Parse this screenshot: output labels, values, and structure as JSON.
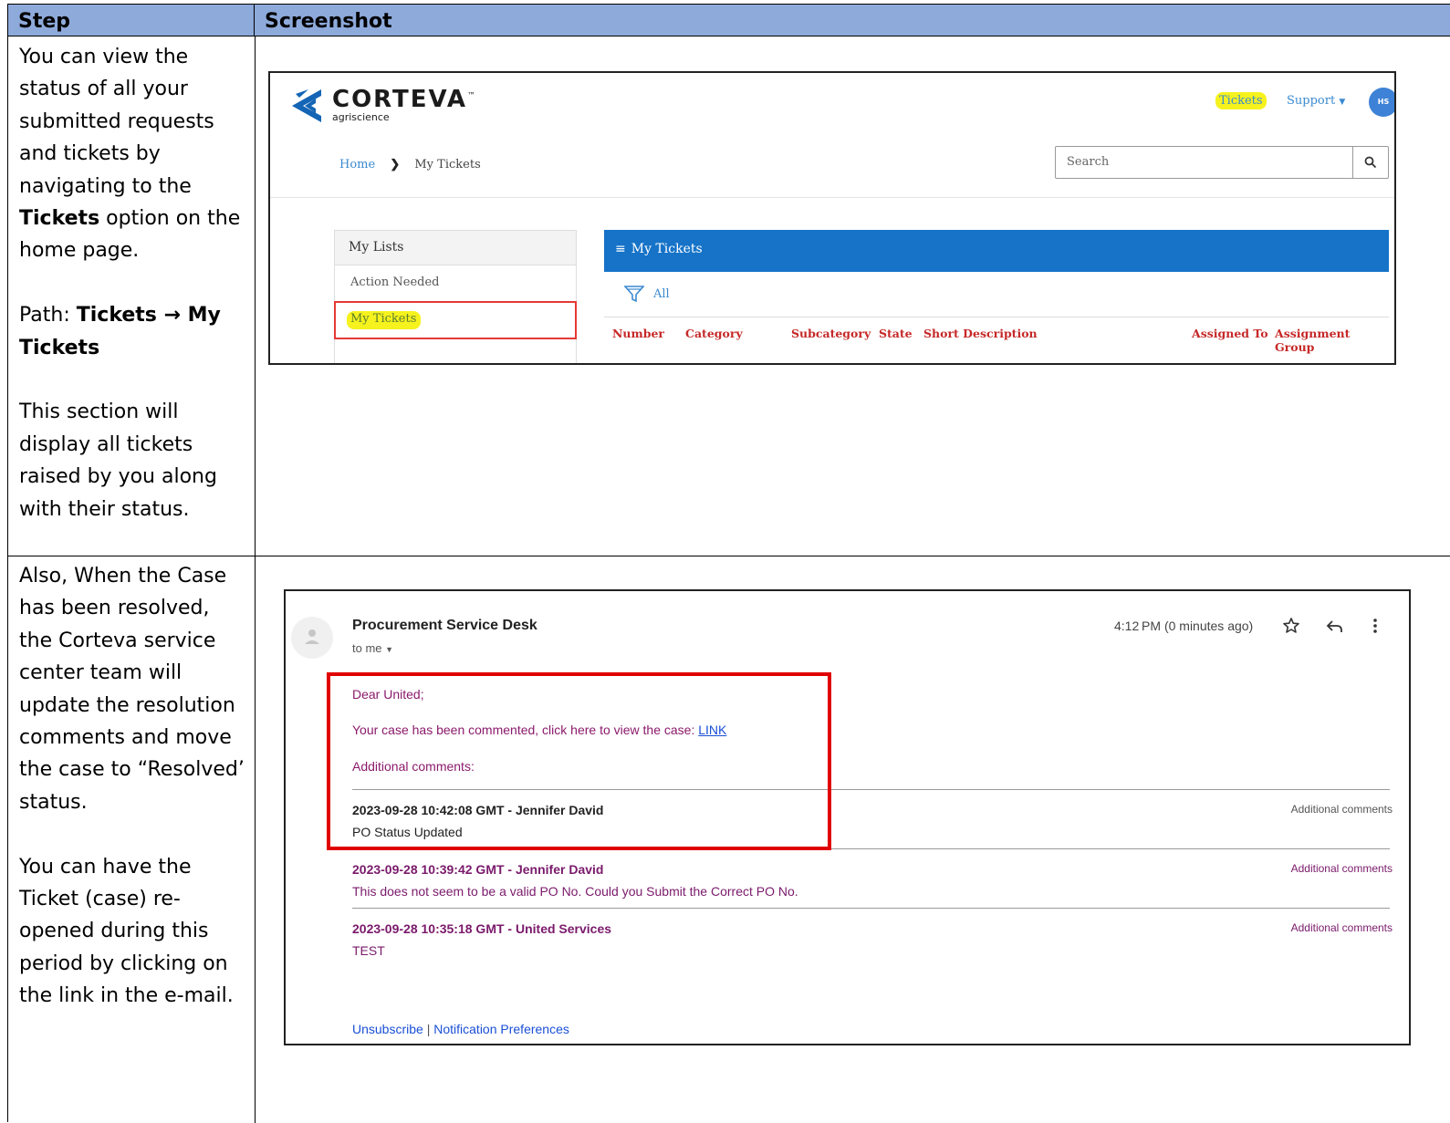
{
  "table": {
    "col_step": "Step",
    "col_screenshot": "Screenshot"
  },
  "rows": [
    {
      "step_lines": {
        "p1": "You can view the status of all your submitted requests and tickets by navigating to the ",
        "p1_bold": "Tickets",
        "p1_end": " option on the home page.",
        "p2_label": "Path: ",
        "p2_bold": "Tickets → My Tickets",
        "p3": "This section will display all tickets raised by you along with their status."
      }
    },
    {
      "step_lines": {
        "p1": "Also, When the Case has been resolved, the Corteva service center team will update the resolution comments and move the case to “Resolved’ status.",
        "p2": "You can have the Ticket (case) re-opened during this period by clicking on the link in the e-mail."
      }
    }
  ],
  "portal": {
    "brand": "CORTEVA",
    "brand_tm": "™",
    "brand_sub": "agriscience",
    "nav_tickets": "Tickets",
    "nav_support": "Support",
    "avatar_initials": "HS",
    "breadcrumb_home": "Home",
    "breadcrumb_current": "My Tickets",
    "search_placeholder": "Search",
    "lists_title": "My Lists",
    "lists_items": [
      "Action Needed",
      "My Tickets"
    ],
    "panel_title": "My Tickets",
    "filter_label": "All",
    "columns": [
      "Number",
      "Category",
      "Subcategory",
      "State",
      "Short Description",
      "Assigned To",
      "Assignment Group"
    ],
    "colors": {
      "header_blue": "#1673c8",
      "highlight_yellow": "#f6f21e",
      "column_red": "#c62828"
    }
  },
  "email": {
    "sender": "Procurement Service Desk",
    "to": "to me",
    "time": "4:12 PM (0 minutes ago)",
    "greeting": "Dear United;",
    "message_prefix": "Your case has been commented, click here to view the case: ",
    "link_text": "LINK",
    "additional_label": "Additional comments:",
    "entries": [
      {
        "header": "2023-09-28 10:42:08 GMT - Jennifer David",
        "body": "PO Status Updated",
        "tag": "Additional comments"
      },
      {
        "header": "2023-09-28 10:39:42 GMT - Jennifer David",
        "body": "This does not seem to be a valid PO No. Could you Submit the Correct PO No.",
        "tag": "Additional comments"
      },
      {
        "header": "2023-09-28 10:35:18 GMT - United Services",
        "body": "TEST",
        "tag": "Additional comments"
      }
    ],
    "footer_unsubscribe": "Unsubscribe",
    "footer_separator": "|",
    "footer_preferences": "Notification Preferences"
  }
}
